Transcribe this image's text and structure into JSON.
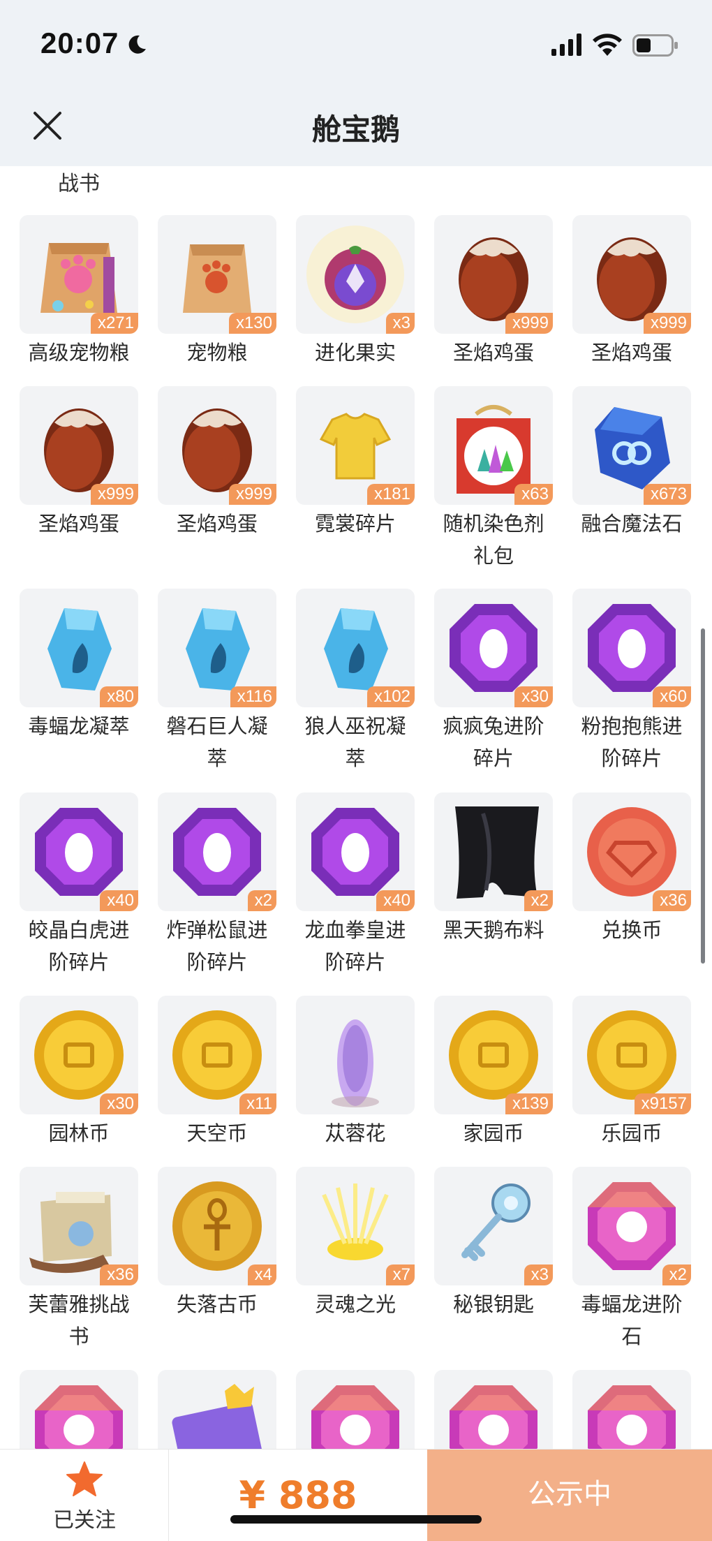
{
  "status_bar": {
    "time": "20:07"
  },
  "header": {
    "title": "舱宝鹅"
  },
  "partial_top_label": "战书",
  "items": [
    {
      "name": "高级宠物粮",
      "count": "x271",
      "icon": "premium-pet-food-bag"
    },
    {
      "name": "宠物粮",
      "count": "x130",
      "icon": "pet-food-bag"
    },
    {
      "name": "进化果实",
      "count": "x3",
      "icon": "evolution-fruit"
    },
    {
      "name": "圣焰鸡蛋",
      "count": "x999",
      "icon": "holy-flame-egg"
    },
    {
      "name": "圣焰鸡蛋",
      "count": "x999",
      "icon": "holy-flame-egg"
    },
    {
      "name": "圣焰鸡蛋",
      "count": "x999",
      "icon": "holy-flame-egg"
    },
    {
      "name": "圣焰鸡蛋",
      "count": "x999",
      "icon": "holy-flame-egg"
    },
    {
      "name": "霓裳碎片",
      "count": "x181",
      "icon": "yellow-shirt"
    },
    {
      "name": "随机染色剂礼包",
      "count": "x63",
      "icon": "dye-gift-pack"
    },
    {
      "name": "融合魔法石",
      "count": "x673",
      "icon": "fusion-magic-stone"
    },
    {
      "name": "毒蝠龙凝萃",
      "count": "x80",
      "icon": "blue-crystal"
    },
    {
      "name": "磐石巨人凝萃",
      "count": "x116",
      "icon": "blue-crystal"
    },
    {
      "name": "狼人巫祝凝萃",
      "count": "x102",
      "icon": "blue-crystal"
    },
    {
      "name": "疯疯兔进阶碎片",
      "count": "x30",
      "icon": "purple-gem"
    },
    {
      "name": "粉抱抱熊进阶碎片",
      "count": "x60",
      "icon": "purple-gem"
    },
    {
      "name": "皎晶白虎进阶碎片",
      "count": "x40",
      "icon": "purple-gem"
    },
    {
      "name": "炸弹松鼠进阶碎片",
      "count": "x2",
      "icon": "purple-gem"
    },
    {
      "name": "龙血拳皇进阶碎片",
      "count": "x40",
      "icon": "purple-gem"
    },
    {
      "name": "黑天鹅布料",
      "count": "x2",
      "icon": "black-cloth"
    },
    {
      "name": "兑换币",
      "count": "x36",
      "icon": "exchange-coin"
    },
    {
      "name": "园林币",
      "count": "x30",
      "icon": "gold-coin"
    },
    {
      "name": "天空币",
      "count": "x11",
      "icon": "gold-coin"
    },
    {
      "name": "苁蓉花",
      "count": "",
      "icon": "cistanche-flower"
    },
    {
      "name": "家园币",
      "count": "x139",
      "icon": "gold-coin"
    },
    {
      "name": "乐园币",
      "count": "x9157",
      "icon": "gold-coin"
    },
    {
      "name": "芙蕾雅挑战书",
      "count": "x36",
      "icon": "wanted-scroll"
    },
    {
      "name": "失落古币",
      "count": "x4",
      "icon": "ankh-coin"
    },
    {
      "name": "灵魂之光",
      "count": "x7",
      "icon": "soul-light"
    },
    {
      "name": "秘银钥匙",
      "count": "x3",
      "icon": "mithril-key"
    },
    {
      "name": "毒蝠龙进阶石",
      "count": "x2",
      "icon": "pink-gem"
    },
    {
      "name": "",
      "count": "",
      "icon": "pink-gem"
    },
    {
      "name": "",
      "count": "",
      "icon": "purple-card"
    },
    {
      "name": "",
      "count": "",
      "icon": "pink-gem"
    },
    {
      "name": "",
      "count": "",
      "icon": "pink-gem"
    },
    {
      "name": "",
      "count": "",
      "icon": "pink-gem"
    }
  ],
  "bottom_bar": {
    "follow_label": "已关注",
    "price": "¥ 888",
    "status_button": "公示中"
  },
  "colors": {
    "accent": "#ef7d2b",
    "badge": "#f3995a",
    "button": "#f3b089",
    "tile": "#f2f3f5"
  }
}
